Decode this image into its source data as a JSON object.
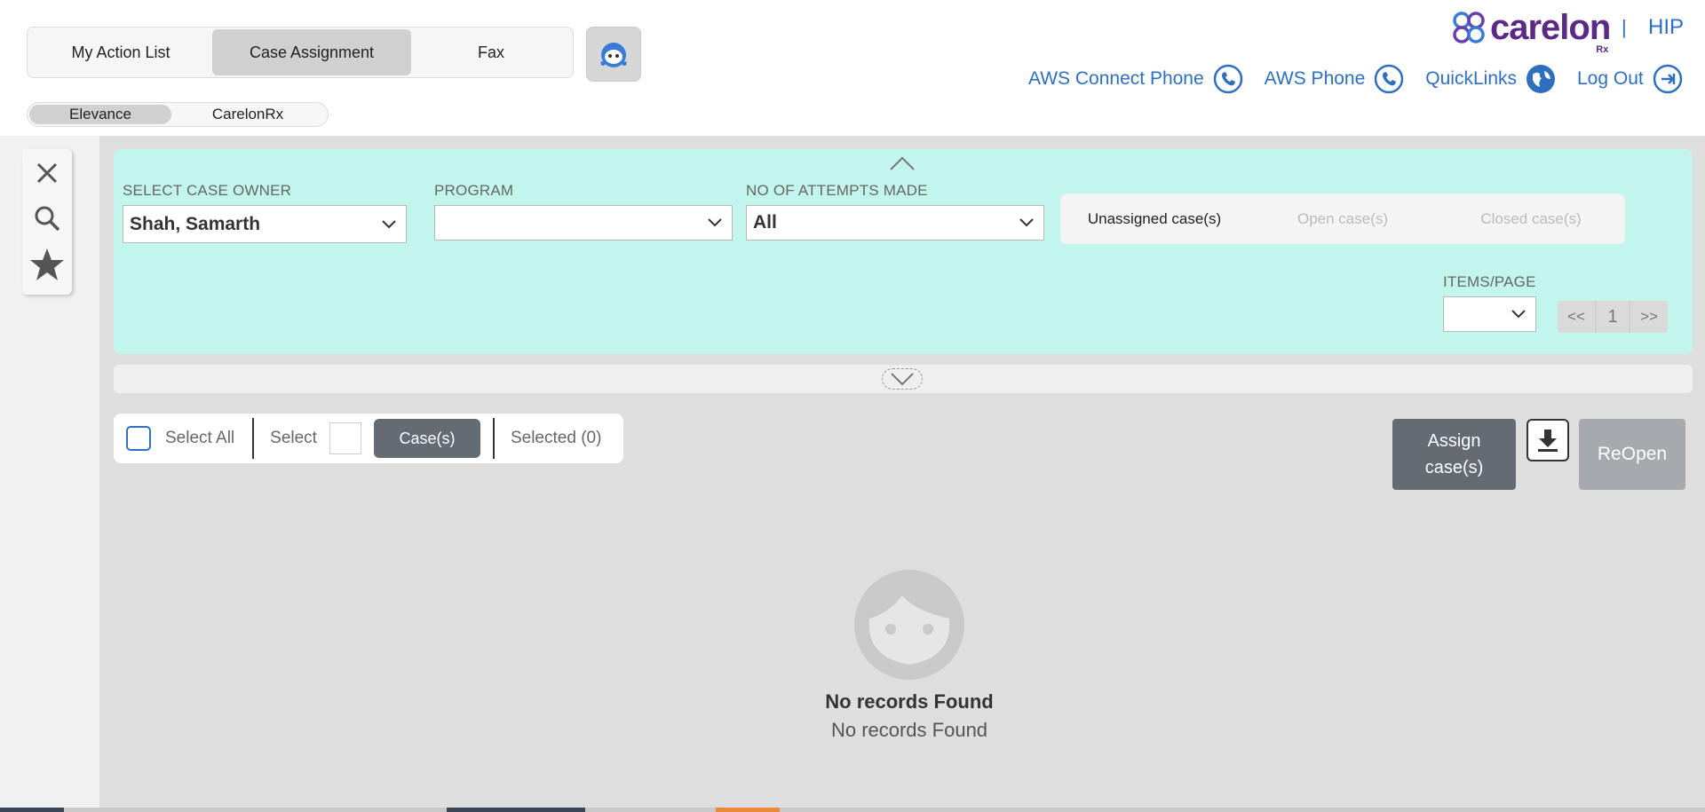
{
  "header": {
    "main_tabs": [
      {
        "label": "My Action List",
        "active": false
      },
      {
        "label": "Case Assignment",
        "active": true
      },
      {
        "label": "Fax",
        "active": false
      }
    ],
    "sub_tabs": [
      {
        "label": "Elevance",
        "active": true
      },
      {
        "label": "CarelonRx",
        "active": false
      }
    ],
    "brand": {
      "name": "carelon",
      "suffix": "Rx",
      "separator": "|",
      "app": "HIP"
    },
    "links": [
      {
        "label": "AWS Connect Phone",
        "icon": "phone-icon"
      },
      {
        "label": "AWS Phone",
        "icon": "phone-icon"
      },
      {
        "label": "QuickLinks",
        "icon": "globe-icon"
      },
      {
        "label": "Log Out",
        "icon": "logout-icon"
      }
    ]
  },
  "tools": [
    "close-icon",
    "search-icon",
    "star-icon"
  ],
  "filters": {
    "case_owner": {
      "label": "SELECT CASE OWNER",
      "value": "Shah, Samarth"
    },
    "program": {
      "label": "PROGRAM",
      "value": ""
    },
    "attempts": {
      "label": "NO OF ATTEMPTS MADE",
      "value": "All"
    },
    "case_status_tabs": [
      {
        "label": "Unassigned case(s)",
        "active": true
      },
      {
        "label": "Open case(s)",
        "active": false
      },
      {
        "label": "Closed case(s)",
        "active": false
      }
    ],
    "items_per_page": {
      "label": "ITEMS/PAGE",
      "value": ""
    },
    "pager": {
      "prev": "<<",
      "page": "1",
      "next": ">>"
    }
  },
  "selection": {
    "select_all": "Select All",
    "select": "Select",
    "cases_button": "Case(s)",
    "selected": "Selected (0)"
  },
  "actions": {
    "assign_line1": "Assign",
    "assign_line2": "case(s)",
    "reopen": "ReOpen"
  },
  "empty_state": {
    "title": "No records Found",
    "subtitle": "No records Found"
  },
  "colors": {
    "accent_blue": "#2e6fc0",
    "brand_purple": "#5b2a86",
    "filter_panel": "#c2f5ec",
    "button_gray": "#656b73"
  }
}
